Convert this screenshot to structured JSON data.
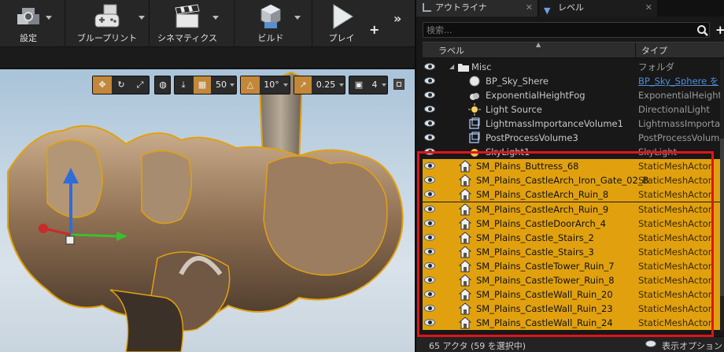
{
  "toolbar": {
    "buttons": [
      {
        "label": "設定",
        "icon": "gear-cubes-icon"
      },
      {
        "label": "ブループリント",
        "icon": "gamepad-icon"
      },
      {
        "label": "シネマティクス",
        "icon": "clapperboard-icon"
      },
      {
        "label": "ビルド",
        "icon": "build-blocks-icon"
      },
      {
        "label": "プレイ",
        "icon": "play-icon"
      }
    ],
    "overflow": "»"
  },
  "viewport": {
    "grid_snap": "50",
    "rotation_snap": "10°",
    "scale_snap": "0.25",
    "camera_speed": "4"
  },
  "outliner": {
    "tab_outliner": "アウトライナ",
    "tab_level": "レベル",
    "search_placeholder": "検索...",
    "col_label": "ラベル",
    "col_type": "タイプ",
    "rows": [
      {
        "name": "Misc",
        "type": "フォルダ",
        "icon": "folder-icon",
        "selected": false,
        "folder": true
      },
      {
        "name": "BP_Sky_Shere",
        "type": "BP_Sky_Sphere を",
        "icon": "sphere-icon",
        "selected": false,
        "link": true
      },
      {
        "name": "ExponentialHeightFog",
        "type": "ExponentialHeightFog",
        "icon": "fog-icon",
        "selected": false
      },
      {
        "name": "Light Source",
        "type": "DirectionalLight",
        "icon": "sun-icon",
        "selected": false
      },
      {
        "name": "LightmassImportanceVolume1",
        "type": "LightmassImportan",
        "icon": "volume-icon",
        "selected": false
      },
      {
        "name": "PostProcessVolume3",
        "type": "PostProcessVolume",
        "icon": "volume-icon",
        "selected": false
      },
      {
        "name": "SkyLight1",
        "type": "SkyLight",
        "icon": "skylight-icon",
        "selected": false
      },
      {
        "name": "SM_Plains_Buttress_68",
        "type": "StaticMeshActor",
        "icon": "house-icon",
        "selected": true
      },
      {
        "name": "SM_Plains_CastleArch_Iron_Gate_02_B",
        "type": "StaticMeshActor",
        "icon": "house-icon",
        "selected": true
      },
      {
        "name": "SM_Plains_CastleArch_Ruin_8",
        "type": "StaticMeshActor",
        "icon": "house-icon",
        "selected": true
      },
      {
        "name": "SM_Plains_CastleArch_Ruin_9",
        "type": "StaticMeshActor",
        "icon": "house-icon",
        "selected": true
      },
      {
        "name": "SM_Plains_CastleDoorArch_4",
        "type": "StaticMeshActor",
        "icon": "house-icon",
        "selected": true
      },
      {
        "name": "SM_Plains_Castle_Stairs_2",
        "type": "StaticMeshActor",
        "icon": "house-icon",
        "selected": true
      },
      {
        "name": "SM_Plains_Castle_Stairs_3",
        "type": "StaticMeshActor",
        "icon": "house-icon",
        "selected": true
      },
      {
        "name": "SM_Plains_CastleTower_Ruin_7",
        "type": "StaticMeshActor",
        "icon": "house-icon",
        "selected": true
      },
      {
        "name": "SM_Plains_CastleTower_Ruin_8",
        "type": "StaticMeshActor",
        "icon": "house-icon",
        "selected": true
      },
      {
        "name": "SM_Plains_CastleWall_Ruin_20",
        "type": "StaticMeshActor",
        "icon": "house-icon",
        "selected": true
      },
      {
        "name": "SM_Plains_CastleWall_Ruin_23",
        "type": "StaticMeshActor",
        "icon": "house-icon",
        "selected": true
      },
      {
        "name": "SM_Plains_CastleWall_Ruin_24",
        "type": "StaticMeshActor",
        "icon": "house-icon",
        "selected": true
      }
    ],
    "footer_count": "65 アクタ (59 を選択中)",
    "footer_options": "表示オプション"
  },
  "colors": {
    "selection": "#e1a10f",
    "highlight_box": "#e2131d",
    "toolbar_bg": "#262626",
    "panel_bg": "#181818"
  }
}
